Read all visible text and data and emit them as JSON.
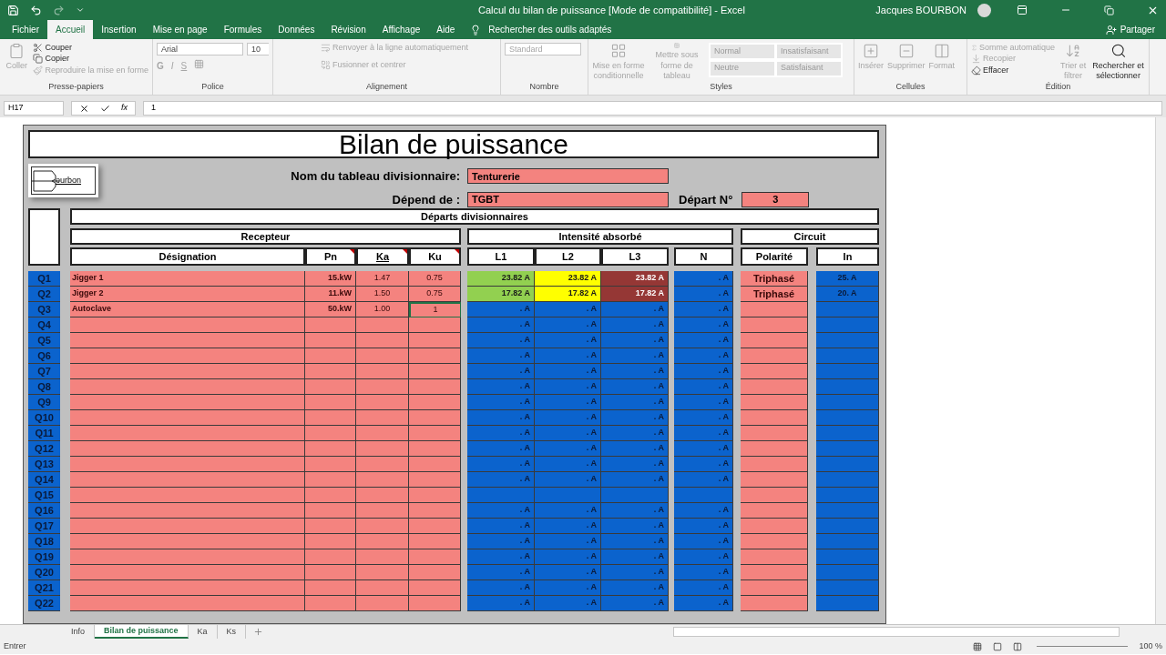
{
  "window": {
    "title": "Calcul du bilan de puissance  [Mode de compatibilité]  -  Excel",
    "user": "Jacques BOURBON"
  },
  "menu_tabs": [
    {
      "label": "Fichier",
      "selected": false
    },
    {
      "label": "Accueil",
      "selected": true
    },
    {
      "label": "Insertion",
      "selected": false
    },
    {
      "label": "Mise en page",
      "selected": false
    },
    {
      "label": "Formules",
      "selected": false
    },
    {
      "label": "Données",
      "selected": false
    },
    {
      "label": "Révision",
      "selected": false
    },
    {
      "label": "Affichage",
      "selected": false
    },
    {
      "label": "Aide",
      "selected": false
    }
  ],
  "tell_me": "Rechercher des outils adaptés",
  "share": "Partager",
  "ribbon": {
    "clipboard": {
      "label": "Presse-papiers",
      "paste": "Coller",
      "cut": "Couper",
      "copy": "Copier",
      "painter": "Reproduire la mise en forme"
    },
    "font": {
      "label": "Police",
      "family": "Arial",
      "size": "10",
      "bold": "G",
      "italic": "I",
      "underline": "S"
    },
    "alignment": {
      "label": "Alignement",
      "wrap": "Renvoyer à la ligne automatiquement",
      "merge": "Fusionner et centrer"
    },
    "number": {
      "label": "Nombre",
      "format": "Standard"
    },
    "styles": {
      "label": "Styles",
      "conditional": "Mise en forme conditionnelle",
      "as_table": "Mettre sous forme de tableau",
      "cells": [
        "Normal",
        "Insatisfaisant",
        "Neutre",
        "Satisfaisant"
      ]
    },
    "cells": {
      "label": "Cellules",
      "items": [
        "Insérer",
        "Supprimer",
        "Format"
      ]
    },
    "editing": {
      "label": "Édition",
      "autosum": "Somme automatique",
      "fill": "Recopier",
      "clear": "Effacer",
      "sort": "Trier et filtrer",
      "find": "Rechercher et sélectionner"
    }
  },
  "formula_bar": {
    "name_box": "H17",
    "fx": "fx",
    "value": "1"
  },
  "sheet": {
    "title": "Bilan de puissance",
    "logo_text": "ourbon",
    "fields": [
      {
        "label": "Nom du tableau divisionnaire:",
        "value": "Tenturerie"
      },
      {
        "label": "Dépend de :",
        "value": "TGBT"
      }
    ],
    "depart": {
      "label": "Départ N°",
      "value": "3"
    },
    "section": "Départs divisionnaires",
    "groups": [
      "Recepteur",
      "Intensité absorbé",
      "Circuit"
    ],
    "columns": [
      {
        "label": "Désignation",
        "comment": false
      },
      {
        "label": "Pn",
        "comment": true
      },
      {
        "label": "Ka",
        "comment": true
      },
      {
        "label": "Ku",
        "comment": true
      },
      {
        "label": "L1",
        "comment": false
      },
      {
        "label": "L2",
        "comment": false
      },
      {
        "label": "L3",
        "comment": false
      },
      {
        "label": "N",
        "comment": false
      },
      {
        "label": "Polarité",
        "comment": false
      },
      {
        "label": "In",
        "comment": false
      }
    ],
    "rows": [
      {
        "q": "Q1",
        "designation": "Jigger 1",
        "pn": "15.kW",
        "ka": "1.47",
        "ku": "0.75",
        "ku_active": false,
        "phases": [
          {
            "value": "23.82 A",
            "color": "#92d050"
          },
          {
            "value": "23.82 A",
            "color": "#ffff00"
          },
          {
            "value": "23.82 A",
            "color": "#953735"
          }
        ],
        "n": ". A",
        "polarite": "Triphasé",
        "in": "25. A"
      },
      {
        "q": "Q2",
        "designation": "Jigger 2",
        "pn": "11.kW",
        "ka": "1.50",
        "ku": "0.75",
        "ku_active": false,
        "phases": [
          {
            "value": "17.82 A",
            "color": "#92d050"
          },
          {
            "value": "17.82 A",
            "color": "#ffff00"
          },
          {
            "value": "17.82 A",
            "color": "#953735"
          }
        ],
        "n": ". A",
        "polarite": "Triphasé",
        "in": "20. A"
      },
      {
        "q": "Q3",
        "designation": "Autoclave",
        "pn": "50.kW",
        "ka": "1.00",
        "ku": "1",
        "ku_active": true,
        "phases": [
          {
            "value": ". A",
            "color": "#0b63cd"
          },
          {
            "value": ". A",
            "color": "#0b63cd"
          },
          {
            "value": ". A",
            "color": "#0b63cd"
          }
        ],
        "n": ". A"
      },
      {
        "q": "Q4",
        "ku_active": false,
        "phases": [
          {
            "value": ". A",
            "color": "#0b63cd"
          },
          {
            "value": ". A",
            "color": "#0b63cd"
          },
          {
            "value": ". A",
            "color": "#0b63cd"
          }
        ],
        "n": ". A"
      },
      {
        "q": "Q5",
        "ku_active": false,
        "phases": [
          {
            "value": ". A",
            "color": "#0b63cd"
          },
          {
            "value": ". A",
            "color": "#0b63cd"
          },
          {
            "value": ". A",
            "color": "#0b63cd"
          }
        ],
        "n": ". A"
      },
      {
        "q": "Q6",
        "ku_active": false,
        "phases": [
          {
            "value": ". A",
            "color": "#0b63cd"
          },
          {
            "value": ". A",
            "color": "#0b63cd"
          },
          {
            "value": ". A",
            "color": "#0b63cd"
          }
        ],
        "n": ". A"
      },
      {
        "q": "Q7",
        "ku_active": false,
        "phases": [
          {
            "value": ". A",
            "color": "#0b63cd"
          },
          {
            "value": ". A",
            "color": "#0b63cd"
          },
          {
            "value": ". A",
            "color": "#0b63cd"
          }
        ],
        "n": ". A"
      },
      {
        "q": "Q8",
        "ku_active": false,
        "phases": [
          {
            "value": ". A",
            "color": "#0b63cd"
          },
          {
            "value": ". A",
            "color": "#0b63cd"
          },
          {
            "value": ". A",
            "color": "#0b63cd"
          }
        ],
        "n": ". A"
      },
      {
        "q": "Q9",
        "ku_active": false,
        "phases": [
          {
            "value": ". A",
            "color": "#0b63cd"
          },
          {
            "value": ". A",
            "color": "#0b63cd"
          },
          {
            "value": ". A",
            "color": "#0b63cd"
          }
        ],
        "n": ". A"
      },
      {
        "q": "Q10",
        "ku_active": false,
        "phases": [
          {
            "value": ". A",
            "color": "#0b63cd"
          },
          {
            "value": ". A",
            "color": "#0b63cd"
          },
          {
            "value": ". A",
            "color": "#0b63cd"
          }
        ],
        "n": ". A"
      },
      {
        "q": "Q11",
        "ku_active": false,
        "phases": [
          {
            "value": ". A",
            "color": "#0b63cd"
          },
          {
            "value": ". A",
            "color": "#0b63cd"
          },
          {
            "value": ". A",
            "color": "#0b63cd"
          }
        ],
        "n": ". A"
      },
      {
        "q": "Q12",
        "ku_active": false,
        "phases": [
          {
            "value": ". A",
            "color": "#0b63cd"
          },
          {
            "value": ". A",
            "color": "#0b63cd"
          },
          {
            "value": ". A",
            "color": "#0b63cd"
          }
        ],
        "n": ". A"
      },
      {
        "q": "Q13",
        "ku_active": false,
        "phases": [
          {
            "value": ". A",
            "color": "#0b63cd"
          },
          {
            "value": ". A",
            "color": "#0b63cd"
          },
          {
            "value": ". A",
            "color": "#0b63cd"
          }
        ],
        "n": ". A"
      },
      {
        "q": "Q14",
        "ku_active": false,
        "phases": [
          {
            "value": ". A",
            "color": "#0b63cd"
          },
          {
            "value": ". A",
            "color": "#0b63cd"
          },
          {
            "value": ". A",
            "color": "#0b63cd"
          }
        ],
        "n": ". A"
      },
      {
        "q": "Q15",
        "ku_active": false,
        "phases": [
          {
            "color": "#0b63cd"
          },
          {
            "color": "#0b63cd"
          },
          {
            "color": "#0b63cd"
          }
        ]
      },
      {
        "q": "Q16",
        "ku_active": false,
        "phases": [
          {
            "value": ". A",
            "color": "#0b63cd"
          },
          {
            "value": ". A",
            "color": "#0b63cd"
          },
          {
            "value": ". A",
            "color": "#0b63cd"
          }
        ],
        "n": ". A"
      },
      {
        "q": "Q17",
        "ku_active": false,
        "phases": [
          {
            "value": ". A",
            "color": "#0b63cd"
          },
          {
            "value": ". A",
            "color": "#0b63cd"
          },
          {
            "value": ". A",
            "color": "#0b63cd"
          }
        ],
        "n": ". A"
      },
      {
        "q": "Q18",
        "ku_active": false,
        "phases": [
          {
            "value": ". A",
            "color": "#0b63cd"
          },
          {
            "value": ". A",
            "color": "#0b63cd"
          },
          {
            "value": ". A",
            "color": "#0b63cd"
          }
        ],
        "n": ". A"
      },
      {
        "q": "Q19",
        "ku_active": false,
        "phases": [
          {
            "value": ". A",
            "color": "#0b63cd"
          },
          {
            "value": ". A",
            "color": "#0b63cd"
          },
          {
            "value": ". A",
            "color": "#0b63cd"
          }
        ],
        "n": ". A"
      },
      {
        "q": "Q20",
        "ku_active": false,
        "phases": [
          {
            "value": ". A",
            "color": "#0b63cd"
          },
          {
            "value": ". A",
            "color": "#0b63cd"
          },
          {
            "value": ". A",
            "color": "#0b63cd"
          }
        ],
        "n": ". A"
      },
      {
        "q": "Q21",
        "ku_active": false,
        "phases": [
          {
            "value": ". A",
            "color": "#0b63cd"
          },
          {
            "value": ". A",
            "color": "#0b63cd"
          },
          {
            "value": ". A",
            "color": "#0b63cd"
          }
        ],
        "n": ". A"
      },
      {
        "q": "Q22",
        "ku_active": false,
        "phases": [
          {
            "value": ". A",
            "color": "#0b63cd"
          },
          {
            "value": ". A",
            "color": "#0b63cd"
          },
          {
            "value": ". A",
            "color": "#0b63cd"
          }
        ],
        "n": ". A"
      }
    ]
  },
  "sheet_tabs": [
    {
      "label": "Info",
      "selected": false
    },
    {
      "label": "Bilan de puissance",
      "selected": true
    },
    {
      "label": "Ka",
      "selected": false
    },
    {
      "label": "Ks",
      "selected": false
    }
  ],
  "status_bar": {
    "mode": "Entrer",
    "zoom": "100 %"
  }
}
